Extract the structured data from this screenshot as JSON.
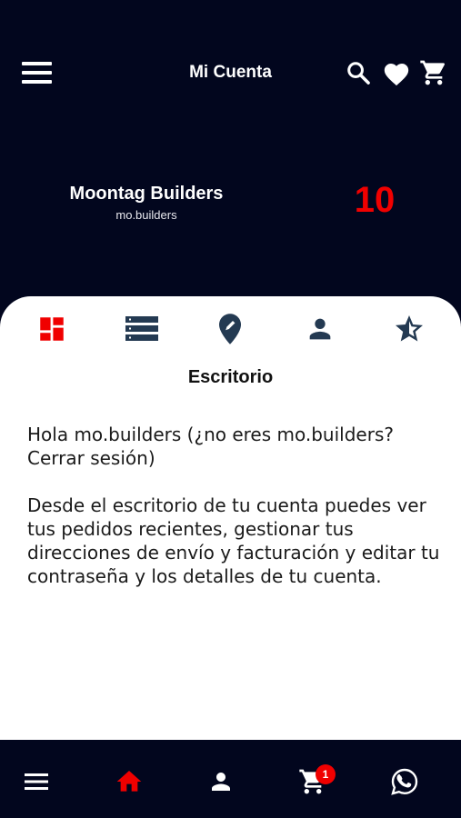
{
  "header": {
    "title": "Mi Cuenta",
    "icons": [
      "menu-icon",
      "search-icon",
      "heart-icon",
      "cart-icon"
    ]
  },
  "profile": {
    "name": "Moontag Builders",
    "username": "mo.builders",
    "points": "10"
  },
  "tabs": [
    {
      "name": "dashboard",
      "icon": "dashboard-icon",
      "active": true
    },
    {
      "name": "orders",
      "icon": "list-icon",
      "active": false
    },
    {
      "name": "addresses",
      "icon": "location-pin-icon",
      "active": false
    },
    {
      "name": "account",
      "icon": "person-icon",
      "active": false
    },
    {
      "name": "reviews",
      "icon": "star-icon",
      "active": false
    }
  ],
  "section": {
    "title": "Escritorio",
    "paragraph1": "Hola mo.builders (¿no eres mo.builders? Cerrar sesión)",
    "paragraph2": "Desde el escritorio de tu cuenta puedes ver tus pedidos recientes, gestionar tus direcciones de envío y facturación y editar tu contraseña y los detalles de tu cuenta."
  },
  "bottom_nav": {
    "items": [
      "menu-icon",
      "home-icon",
      "person-icon",
      "cart-icon",
      "whatsapp-icon"
    ],
    "active": "home-icon",
    "cart_badge": "1"
  },
  "colors": {
    "background": "#02061e",
    "accent": "#f00000",
    "icon_muted": "#243a52",
    "card": "#ffffff"
  }
}
